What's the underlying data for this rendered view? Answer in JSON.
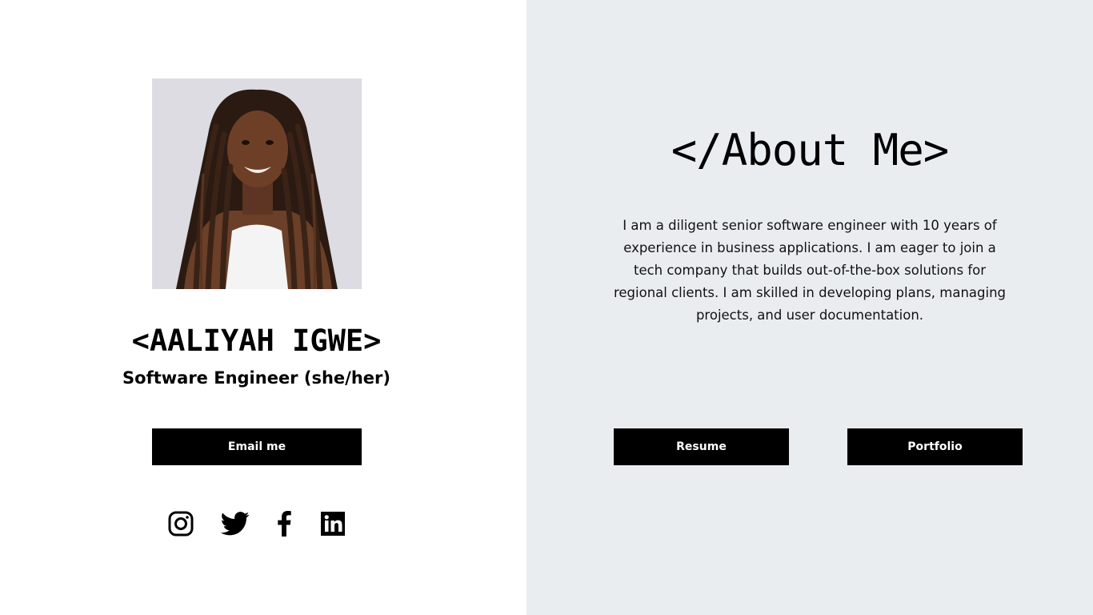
{
  "profile": {
    "name": "<AALIYAH IGWE>",
    "role": "Software Engineer (she/her)",
    "email_label": "Email me",
    "photo_icon": "portrait-photo"
  },
  "social": {
    "icons": [
      "instagram-icon",
      "twitter-icon",
      "facebook-icon",
      "linkedin-icon"
    ]
  },
  "about": {
    "title": "</About Me>",
    "text": "I am a diligent senior software engineer with 10 years of experience in business applications. I am eager to join a tech company that builds out-of-the-box solutions for regional clients. I am skilled in developing plans, managing projects, and user documentation.",
    "resume_label": "Resume",
    "portfolio_label": "Portfolio"
  },
  "colors": {
    "left_bg": "#ffffff",
    "right_bg": "#eaedf0",
    "button_bg": "#000000",
    "button_text": "#ffffff"
  }
}
